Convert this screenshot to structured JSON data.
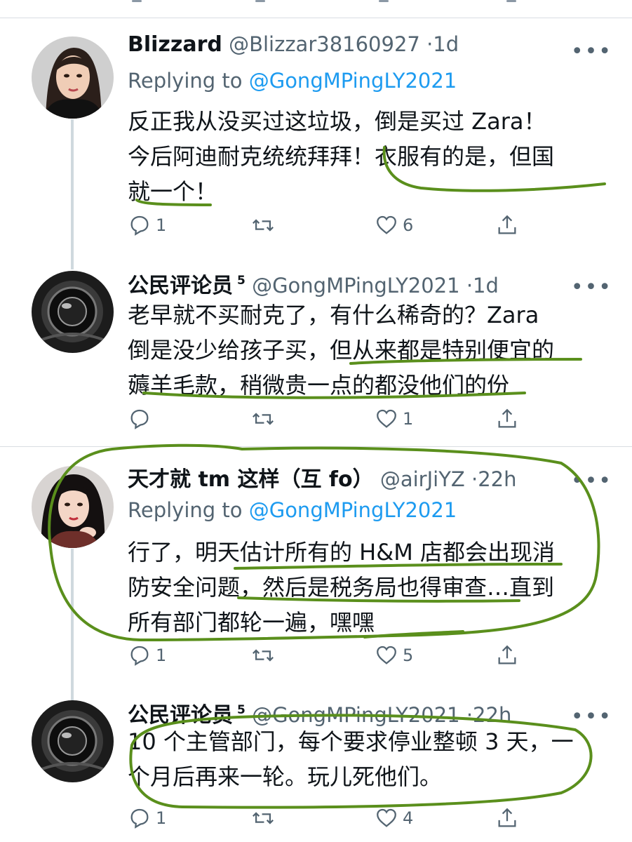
{
  "accent_color": "#1d9bf0",
  "annotation_color": "#5a8f1c",
  "tweets": [
    {
      "name": "Blizzard",
      "verified": "",
      "handle": "@Blizzar38160927",
      "time": "1d",
      "replying_label": "Replying to",
      "replying_to": "@GongMPingLY2021",
      "lines": [
        "反正我从没买过这垃圾，倒是买过 Zara！",
        "今后阿迪耐克统统拜拜！衣服有的是，但国",
        "就一个！"
      ],
      "replies": "1",
      "retweets": "",
      "likes": "6"
    },
    {
      "name": "公民评论员",
      "verified": "5",
      "handle": "@GongMPingLY2021",
      "time": "1d",
      "lines": [
        "老早就不买耐克了，有什么稀奇的？Zara",
        "倒是没少给孩子买，但从来都是特别便宜的",
        "薅羊毛款，稍微贵一点的都没他们的份"
      ],
      "replies": "",
      "retweets": "",
      "likes": "1"
    },
    {
      "name": "天才就 tm 这样（互 fo）",
      "verified": "",
      "handle": "@airJiYZ",
      "time": "22h",
      "replying_label": "Replying to",
      "replying_to": "@GongMPingLY2021",
      "lines": [
        "行了，明天估计所有的 H&M 店都会出现消",
        "防安全问题，然后是税务局也得审查…直到",
        "所有部门都轮一遍，嘿嘿"
      ],
      "replies": "1",
      "retweets": "",
      "likes": "5"
    },
    {
      "name": "公民评论员",
      "verified": "5",
      "handle": "@GongMPingLY2021",
      "time": "22h",
      "lines": [
        "10 个主管部门，每个要求停业整顿 3 天，一",
        "个月后再来一轮。玩儿死他们。"
      ],
      "replies": "1",
      "retweets": "",
      "likes": "4"
    }
  ],
  "icons": {
    "more": "more-icon",
    "reply": "reply-icon",
    "retweet": "retweet-icon",
    "like": "like-icon",
    "share": "share-icon"
  }
}
